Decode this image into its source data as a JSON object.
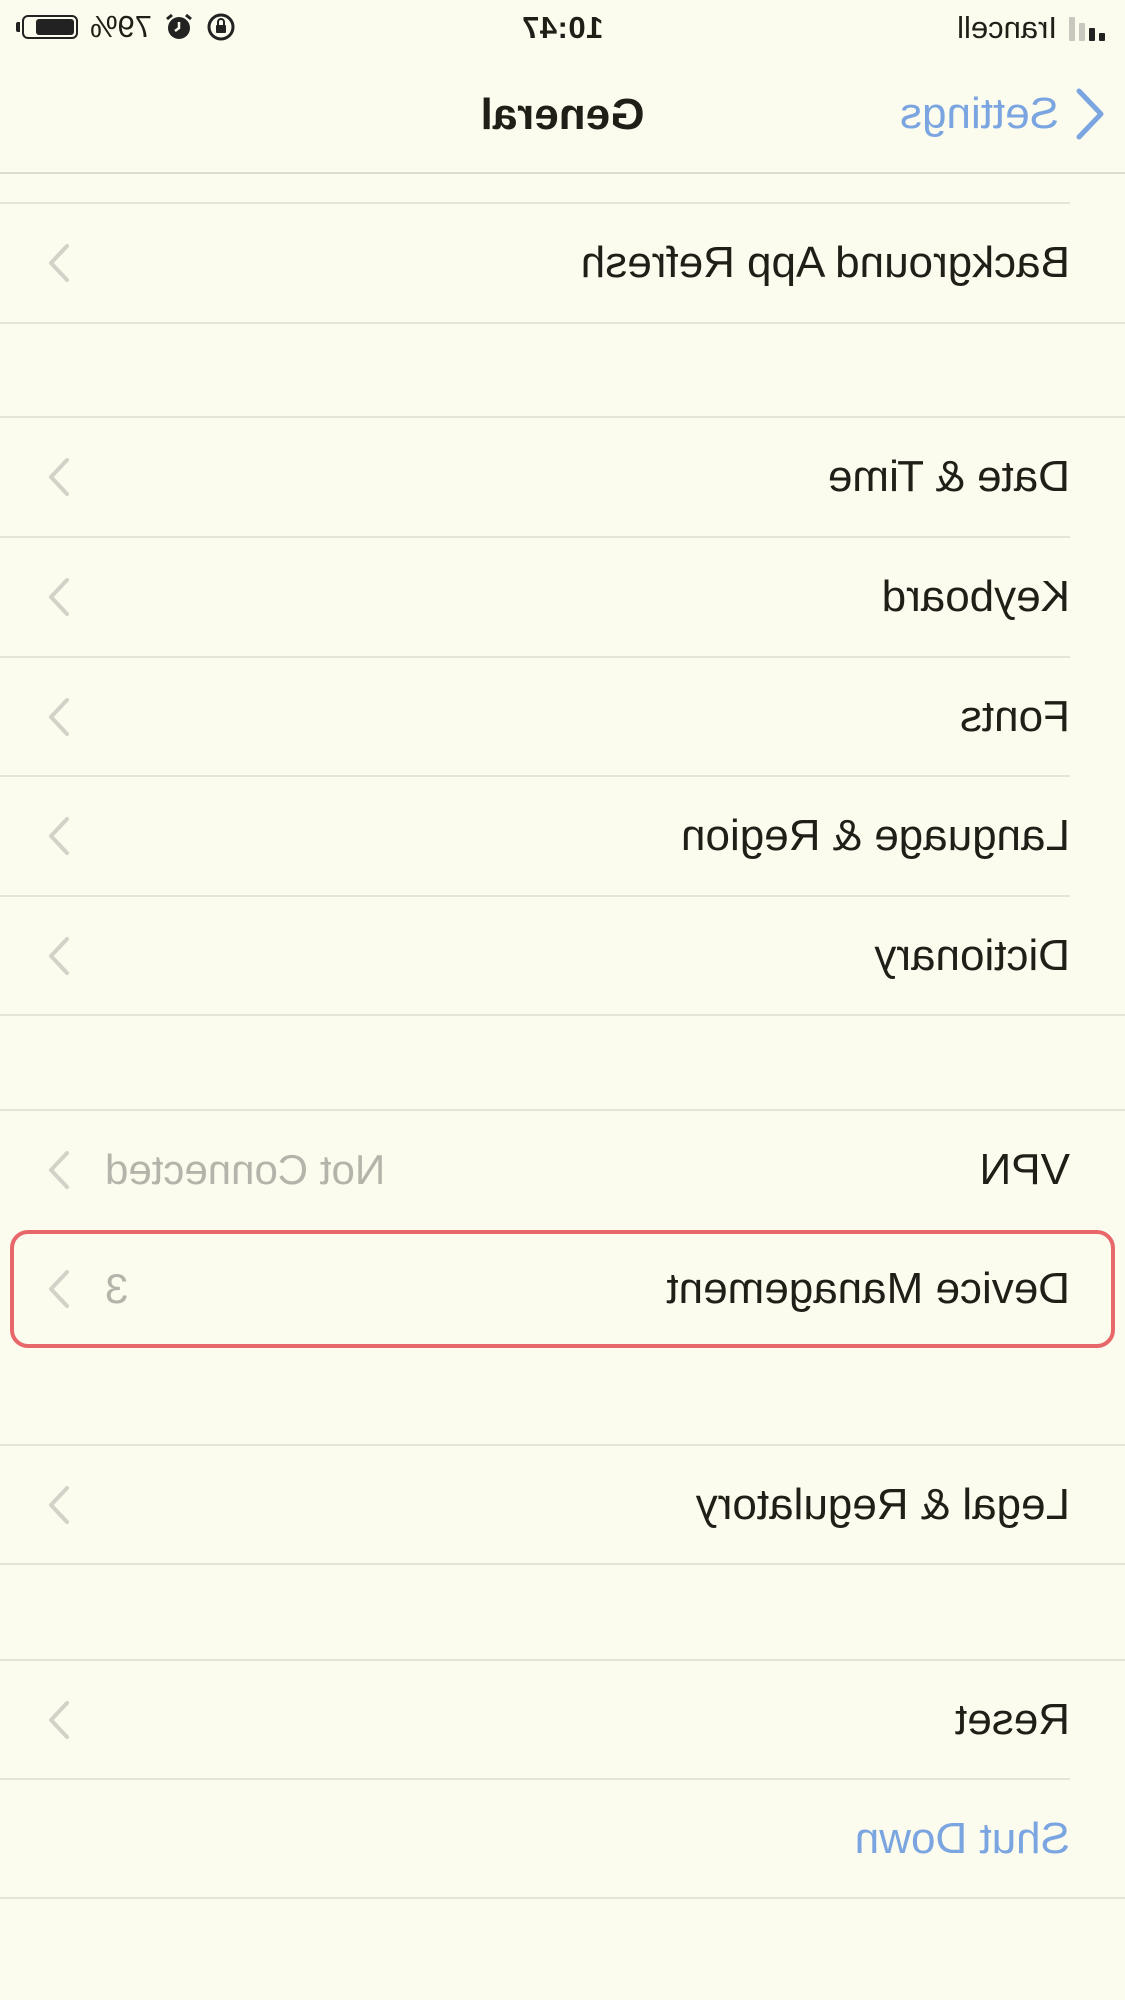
{
  "status_bar": {
    "carrier": "Irancell",
    "time": "10:47",
    "battery": "79%",
    "battery_level": 0.79,
    "icons": [
      "signal-icon",
      "alarm-icon",
      "orientation-lock-icon",
      "battery-icon"
    ]
  },
  "nav": {
    "back_label": "Settings",
    "title": "General"
  },
  "rows": {
    "background_app_refresh": {
      "label": "Background App Refresh"
    },
    "date_time": {
      "label": "Date & Time"
    },
    "keyboard": {
      "label": "Keyboard"
    },
    "fonts": {
      "label": "Fonts"
    },
    "language_region": {
      "label": "Language & Region"
    },
    "dictionary": {
      "label": "Dictionary"
    },
    "vpn": {
      "label": "VPN",
      "detail": "Not Connected"
    },
    "device_management": {
      "label": "Device Management",
      "detail": "3"
    },
    "legal_regulatory": {
      "label": "Legal & Regulatory"
    },
    "reset": {
      "label": "Reset"
    },
    "shut_down": {
      "label": "Shut Down"
    }
  },
  "colors": {
    "background": "#fbfbee",
    "accent": "#7aa5e0",
    "highlight": "#e8676a",
    "separator": "#e4e4d8"
  }
}
